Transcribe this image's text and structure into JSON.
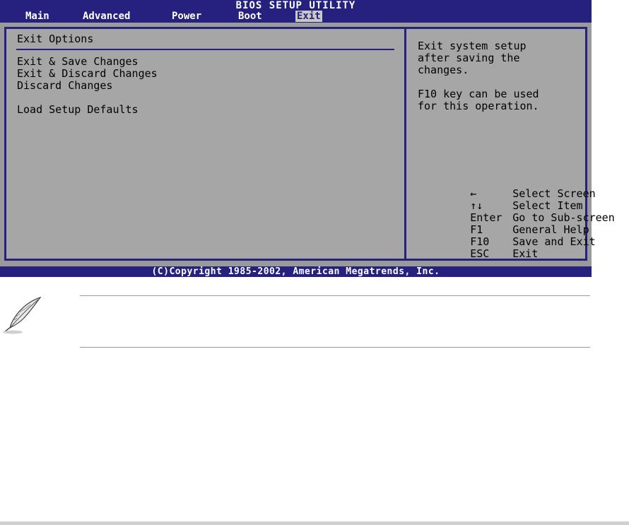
{
  "title": "BIOS SETUP UTILITY",
  "menu": [
    {
      "label": "Main"
    },
    {
      "label": "Advanced"
    },
    {
      "label": "Power"
    },
    {
      "label": "Boot"
    },
    {
      "label": "Exit"
    }
  ],
  "active_menu": "Exit",
  "left": {
    "heading": "Exit Options",
    "options": [
      "Exit & Save Changes",
      "Exit & Discard Changes",
      "Discard Changes",
      "Load Setup Defaults"
    ]
  },
  "help": {
    "lines": [
      "Exit system setup",
      "after saving the",
      "changes.",
      "F10 key can be used",
      "for this operation."
    ]
  },
  "keys": [
    {
      "key": "←",
      "desc": "Select Screen",
      "icon": "left-right-arrow-icon"
    },
    {
      "key": "↑↓",
      "desc": "Select Item",
      "icon": "up-down-arrow-icon"
    },
    {
      "key": "Enter",
      "desc": "Go to Sub-screen"
    },
    {
      "key": "F1",
      "desc": "General Help"
    },
    {
      "key": "F10",
      "desc": "Save and Exit"
    },
    {
      "key": "ESC",
      "desc": "Exit"
    }
  ],
  "footer": "(C)Copyright 1985-2002, American Megatrends, Inc.",
  "colors": {
    "bios_blue": "#26207e",
    "panel_gray": "#a6a6a6"
  }
}
